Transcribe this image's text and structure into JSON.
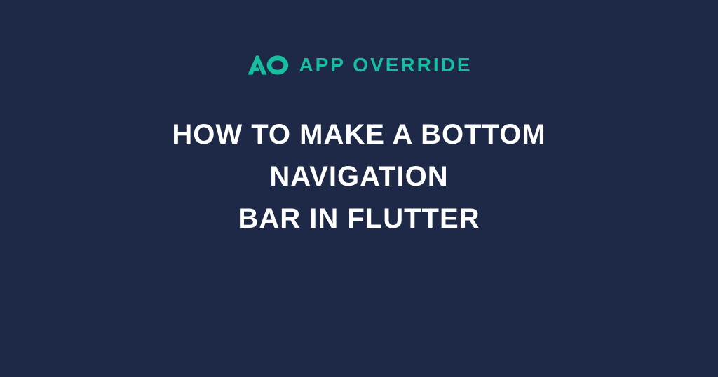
{
  "brand": {
    "name": "APP OVERRIDE",
    "icon_label": "ao-logo-icon"
  },
  "headline": {
    "line1": "HOW TO MAKE A BOTTOM",
    "line2": "NAVIGATION",
    "line3": "BAR IN FLUTTER"
  },
  "colors": {
    "background": "#1e2947",
    "accent": "#16bfa0",
    "text": "#ffffff"
  }
}
